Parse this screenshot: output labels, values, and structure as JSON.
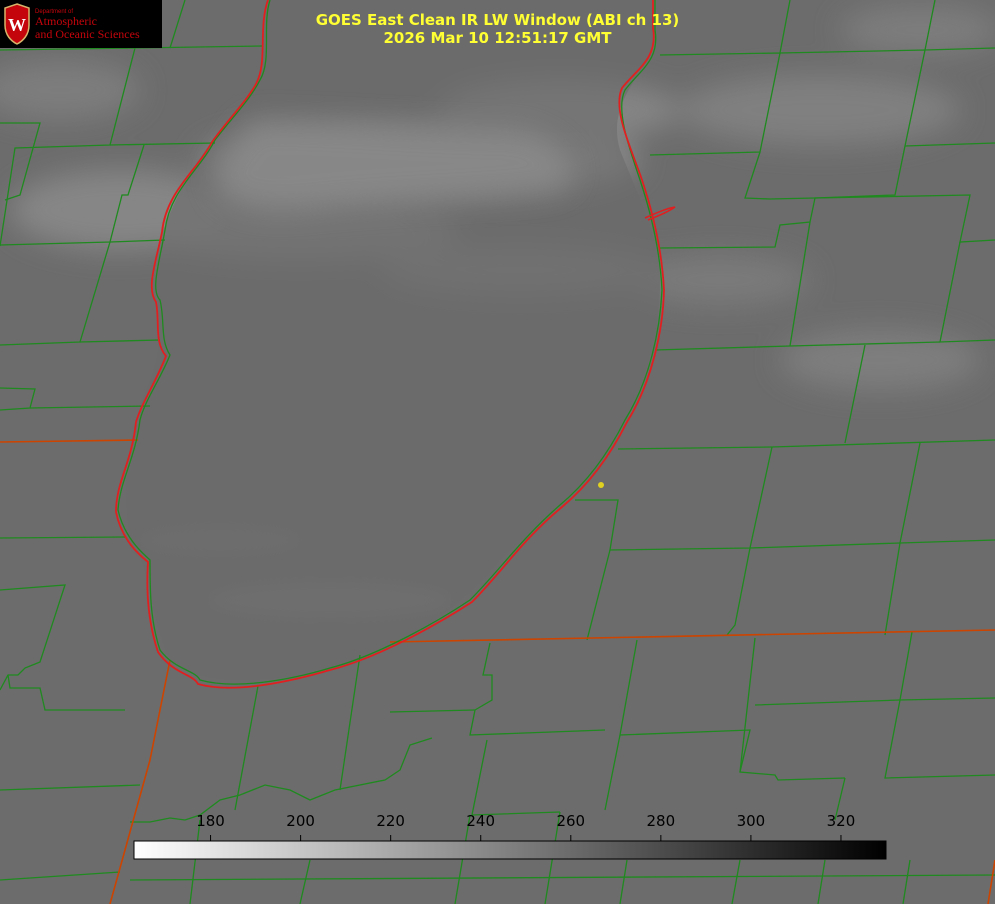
{
  "title": {
    "line1": "GOES East Clean IR LW Window (ABI ch 13)",
    "line2": "2026 Mar 10 12:51:17 GMT"
  },
  "logo": {
    "dept": "Department of",
    "line1": "Atmospheric",
    "line2": "and Oceanic Sciences",
    "seal_letter": "W"
  },
  "colorbar": {
    "min": 163,
    "max": 330,
    "ticks": [
      "180",
      "200",
      "220",
      "240",
      "260",
      "280",
      "300",
      "320"
    ],
    "gradient_start": "#ffffff",
    "gradient_end": "#000000"
  },
  "colors": {
    "background_gray": "#6e6e6e",
    "lake_gray": "#6a6a6a",
    "county_lines": "#1f8a1f",
    "state_lines": "#cc4400",
    "shoreline": "#e02020",
    "title_text": "#ffff33",
    "marker": "#e0d020"
  },
  "icons": {
    "seal": "uw-seal-icon",
    "marker": "location-dot-icon"
  }
}
